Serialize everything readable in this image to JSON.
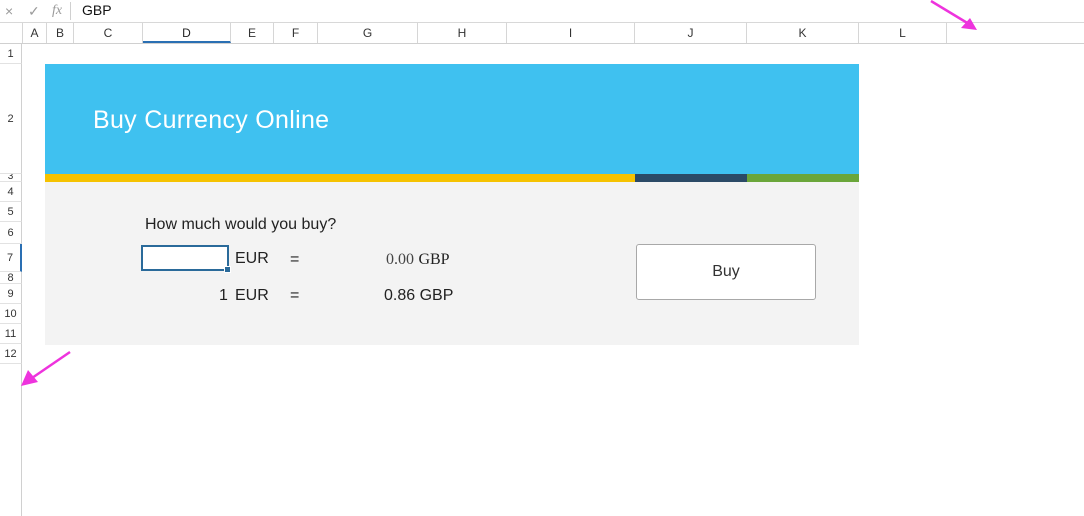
{
  "formula_bar": {
    "cancel_icon": "×",
    "enter_icon": "✓",
    "fx_icon": "fx",
    "value": "GBP"
  },
  "columns": [
    "A",
    "B",
    "C",
    "D",
    "E",
    "F",
    "G",
    "H",
    "I",
    "J",
    "K",
    "L"
  ],
  "selected_column": "D",
  "rows": [
    "1",
    "2",
    "3",
    "4",
    "5",
    "6",
    "7",
    "8",
    "9",
    "10",
    "11",
    "12"
  ],
  "selected_row": "7",
  "banner": {
    "title": "Buy Currency Online",
    "color": "#3fc1f0"
  },
  "stripe_colors": [
    "#f5c200",
    "#2b4a66",
    "#6aa63a"
  ],
  "form": {
    "question": "How much would you buy?",
    "amount_value": "",
    "from_currency": "EUR",
    "equals": "=",
    "converted_value": "0.00",
    "to_currency": "GBP",
    "rate_amount": "1",
    "rate_from": "EUR",
    "rate_equals": "=",
    "rate_value": "0.86 GBP"
  },
  "buy_button": {
    "label": "Buy"
  },
  "annotation_color": "#ee33dd"
}
